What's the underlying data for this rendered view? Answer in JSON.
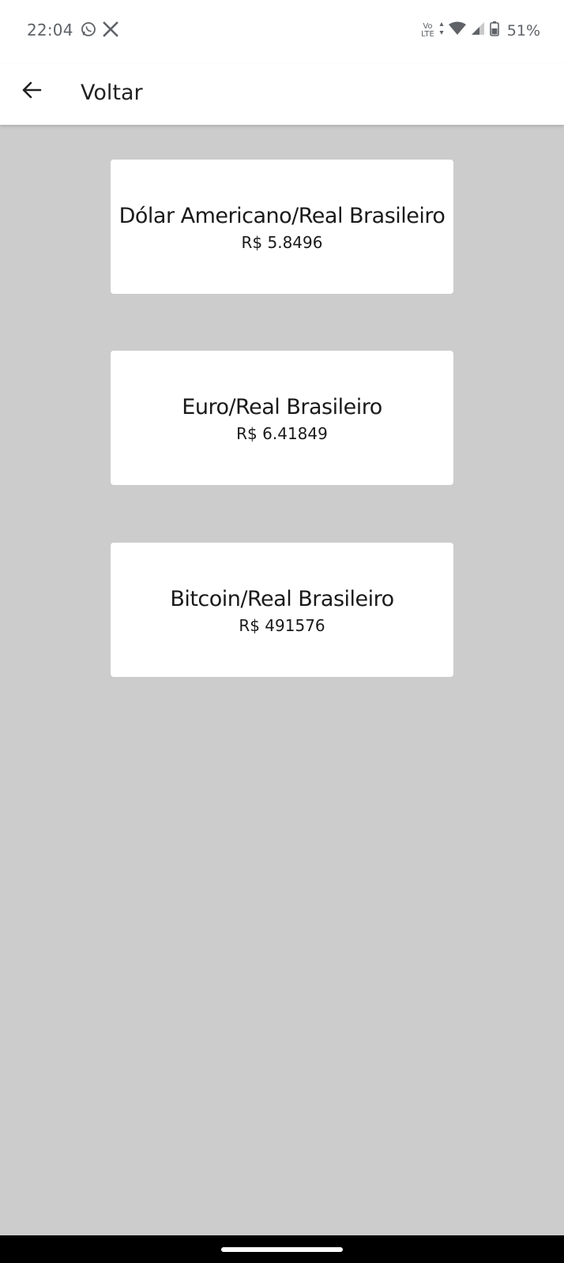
{
  "status_bar": {
    "time": "22:04",
    "app_icons": [
      "whatsapp-icon",
      "x-icon"
    ],
    "network_label_top": "Vo",
    "network_label_bottom": "LTE",
    "battery": "51%"
  },
  "app_bar": {
    "back_icon": "arrow-left-icon",
    "title": "Voltar"
  },
  "quotes": [
    {
      "name": "Dólar Americano/Real Brasileiro",
      "value": "R$ 5.8496"
    },
    {
      "name": "Euro/Real Brasileiro",
      "value": "R$ 6.41849"
    },
    {
      "name": "Bitcoin/Real Brasileiro",
      "value": "R$ 491576"
    }
  ],
  "colors": {
    "background": "#cccccc",
    "surface": "#ffffff",
    "text": "#1a1a1a",
    "status_text": "#5f6368"
  }
}
